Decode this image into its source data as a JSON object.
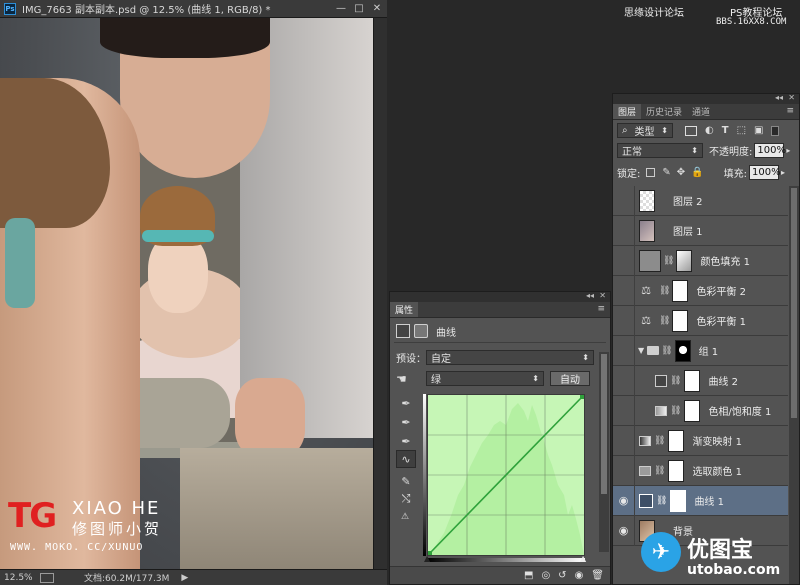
{
  "document": {
    "title": "IMG_7663 副本副本.psd @ 12.5% (曲线 1, RGB/8) *",
    "window_buttons": [
      "—",
      "□",
      "✕"
    ],
    "status": {
      "zoom": "12.5%",
      "doc_size": "文档:60.2M/177.3M"
    }
  },
  "watermarks": {
    "top_right_1": "思缘设计论坛",
    "top_right_2": "PS教程论坛",
    "top_right_3": "BBS.16XX8.COM",
    "brand_tg": "TG",
    "brand_xiao_he": "XIAO HE",
    "brand_cn": "修图师小贺",
    "brand_url": "WWW. MOKO. CC/XUNUO",
    "utobao_cn": "优图宝",
    "utobao_url": "utobao.com"
  },
  "properties": {
    "tab_label": "属性",
    "header_label": "曲线",
    "preset_label": "预设：",
    "preset_value": "自定",
    "channel_value": "绿",
    "auto_label": "自动"
  },
  "layers": {
    "tabs": [
      "图层",
      "历史记录",
      "通道"
    ],
    "filter_kind": "类型",
    "blend_mode": "正常",
    "opacity_label": "不透明度:",
    "opacity_value": "100%",
    "lock_label": "锁定:",
    "fill_label": "填充:",
    "fill_value": "100%",
    "items": [
      {
        "name": "图层 2"
      },
      {
        "name": "图层 1"
      },
      {
        "name": "颜色填充 1"
      },
      {
        "name": "色彩平衡 2"
      },
      {
        "name": "色彩平衡 1"
      },
      {
        "name": "组 1"
      },
      {
        "name": "曲线 2"
      },
      {
        "name": "色相/饱和度 1"
      },
      {
        "name": "渐变映射 1"
      },
      {
        "name": "选取颜色 1"
      },
      {
        "name": "曲线 1"
      },
      {
        "name": "背景"
      }
    ]
  },
  "colors": {
    "accent_selected": "#5d6f86",
    "curve_bg": "#c6f6b6",
    "curve_line": "#2fa23b",
    "brand_red": "#e02020"
  }
}
